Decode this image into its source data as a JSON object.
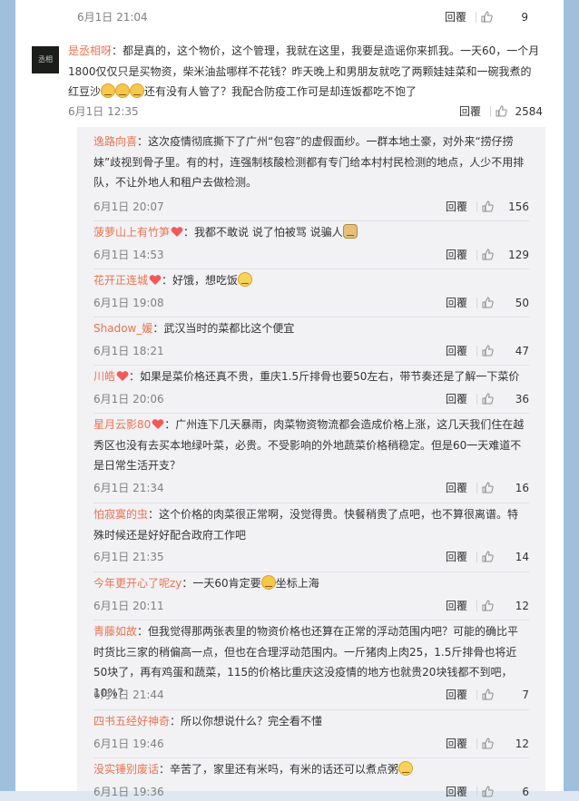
{
  "top": {
    "date": "6月1日 21:04",
    "reply": "回覆",
    "likes": "9"
  },
  "main": {
    "user": "是丞相呀",
    "avatar_text": "丞相",
    "text": "：都是真的，这个物价，这个管理，我就在这里，我要是造谣你来抓我。一天60，一个月1800仅仅只是买物资，柴米油盐哪样不花钱？昨天晚上和男朋友就吃了两颗娃娃菜和一碗我煮的红豆沙",
    "text2": "还有没有人管了？我配合防疫工作可是却连饭都吃不饱了",
    "date": "6月1日 12:35",
    "reply": "回覆",
    "likes": "2584"
  },
  "subs": [
    {
      "user": "逸路向喜",
      "text": "：这次疫情彻底撕下了广州“包容”的虚假面纱。一群本地土豪，对外来“捞仔捞妹”歧视到骨子里。有的村，连强制核酸检测都有专门给本村村民检测的地点，人少不用排队，不让外地人和租户去做检测。",
      "date": "6月1日 20:07",
      "likes": "156"
    },
    {
      "user": "菠萝山上有竹笋",
      "text": "：我都不敢说  说了怕被骂 说骗人",
      "date": "6月1日 14:53",
      "likes": "129"
    },
    {
      "user": "花开正连城",
      "text": "：好饿，想吃饭",
      "date": "6月1日 19:08",
      "likes": "50"
    },
    {
      "user": "Shadow_媛",
      "text": "：武汉当时的菜都比这个便宜",
      "date": "6月1日 18:21",
      "likes": "47"
    },
    {
      "user": "川皓",
      "text": "：如果是菜价格还真不贵，重庆1.5斤排骨也要50左右，带节奏还是了解一下菜价",
      "date": "6月1日 20:06",
      "likes": "36"
    },
    {
      "user": "星月云影80",
      "text": "：广州连下几天暴雨，肉菜物资物流都会造成价格上涨，这几天我们住在越秀区也没有去买本地绿叶菜，必贵。不受影响的外地蔬菜价格稍稳定。但是60一天难道不是日常生活开支？",
      "date": "6月1日 21:34",
      "likes": "16"
    },
    {
      "user": "怕寂寞的虫",
      "text": "：这个价格的肉菜很正常啊，没觉得贵。快餐稍贵了点吧，也不算很离谱。特殊时候还是好好配合政府工作吧",
      "date": "6月1日 21:35",
      "likes": "14"
    },
    {
      "user": "今年更开心了呢zy",
      "text": "：一天60肯定要",
      "text2": "坐标上海",
      "date": "6月1日 20:11",
      "likes": "12"
    },
    {
      "user": "青藤如故",
      "text": "：但我觉得那两张表里的物资价格也还算在正常的浮动范围内吧？可能的确比平时货比三家的稍偏高一点，但也在合理浮动范围内。一斤猪肉上肉25，1.5斤排骨也将近50块了，再有鸡蛋和蔬菜，115的价格比重庆这没疫情的地方也就贵20块钱都不到吧，10%？",
      "date": "6月1日 21:44",
      "likes": "7"
    },
    {
      "user": "四书五经好神奇",
      "text": "：所以你想说什么？完全看不懂",
      "date": "6月1日 19:46",
      "likes": "12"
    },
    {
      "user": "没实锤别废话",
      "text": "：辛苦了，家里还有米吗，有米的话还可以煮点粥",
      "date": "6月1日 19:36",
      "likes": "6"
    }
  ],
  "reply_label": "回覆",
  "colors": {
    "username": "#eb7350",
    "page_bg": "#dfe8f2",
    "reply_bg": "#f2f2f5"
  }
}
